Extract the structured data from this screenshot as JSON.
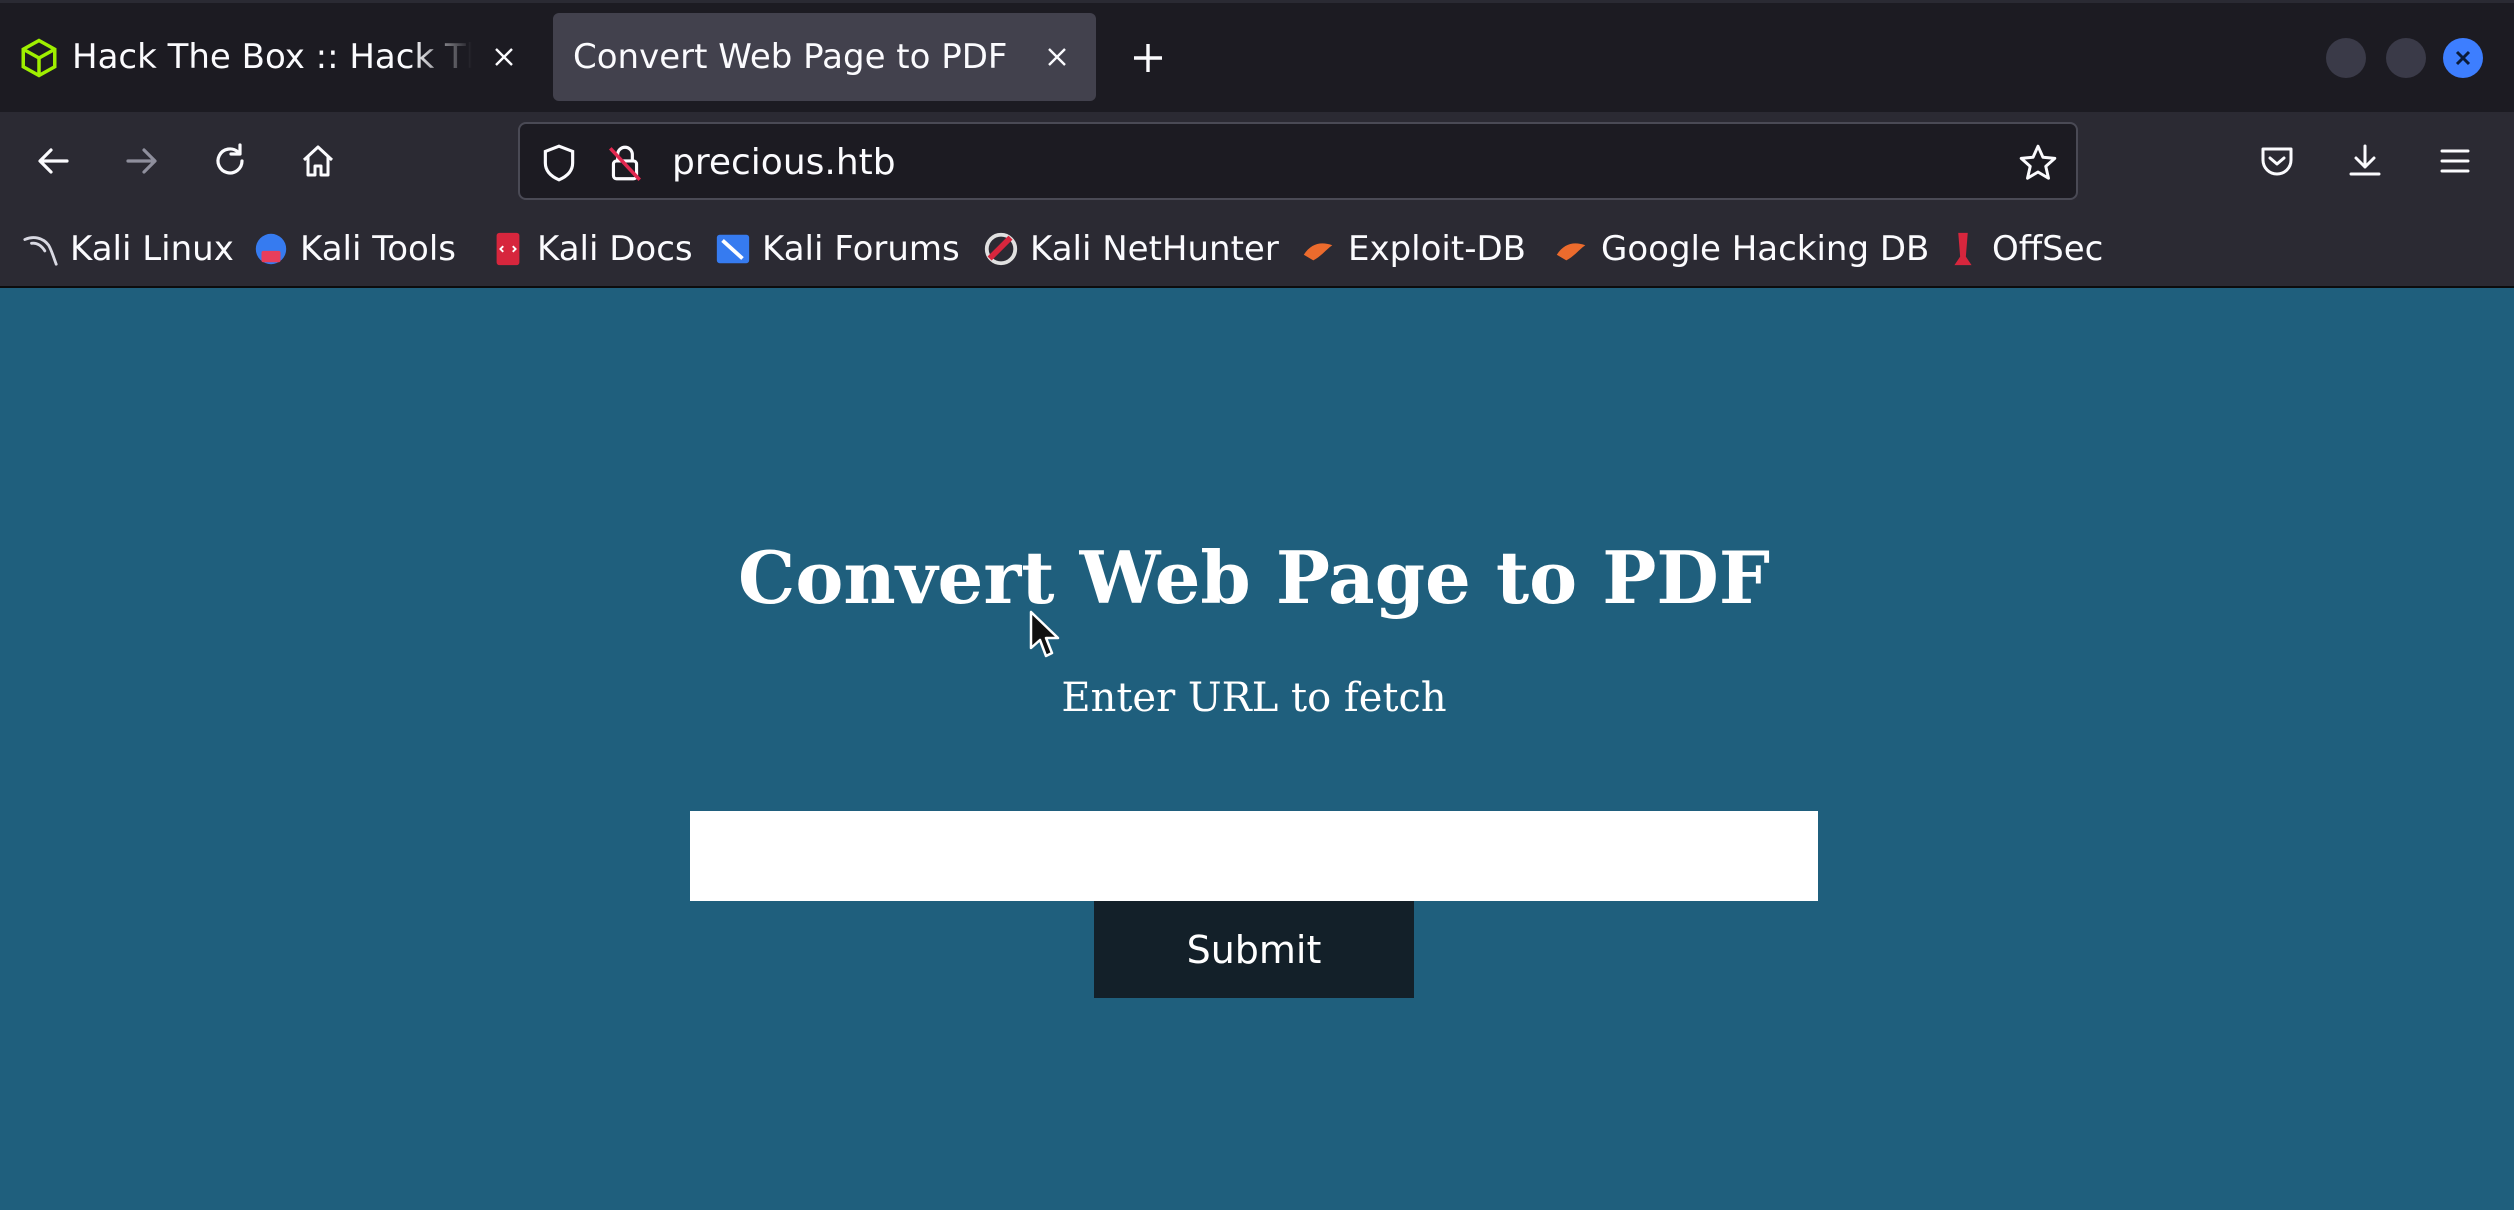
{
  "browser": {
    "tabs": [
      {
        "title": "Hack The Box :: Hack The Box",
        "active": false,
        "icon": "hackthebox-cube-icon"
      },
      {
        "title": "Convert Web Page to PDF",
        "active": true,
        "icon": null
      }
    ],
    "address_bar": {
      "url": "precious.htb"
    },
    "bookmarks": [
      {
        "label": "Kali Linux",
        "icon": "kali-dragon-icon"
      },
      {
        "label": "Kali Tools",
        "icon": "kali-tools-icon"
      },
      {
        "label": "Kali Docs",
        "icon": "kali-docs-icon"
      },
      {
        "label": "Kali Forums",
        "icon": "kali-forums-icon"
      },
      {
        "label": "Kali NetHunter",
        "icon": "kali-nethunter-icon"
      },
      {
        "label": "Exploit-DB",
        "icon": "exploit-db-icon"
      },
      {
        "label": "Google Hacking DB",
        "icon": "ghdb-icon"
      },
      {
        "label": "OffSec",
        "icon": "offsec-icon"
      }
    ],
    "colors": {
      "accent_close": "#3d7eff",
      "tabbar": "#1c1b22",
      "toolbar": "#2b2a33"
    }
  },
  "page": {
    "title": "Convert Web Page to PDF",
    "subtitle": "Enter URL to fetch",
    "url_input": {
      "value": "",
      "placeholder": ""
    },
    "submit_label": "Submit",
    "colors": {
      "background": "#1f5f7d",
      "button": "#132029"
    }
  }
}
